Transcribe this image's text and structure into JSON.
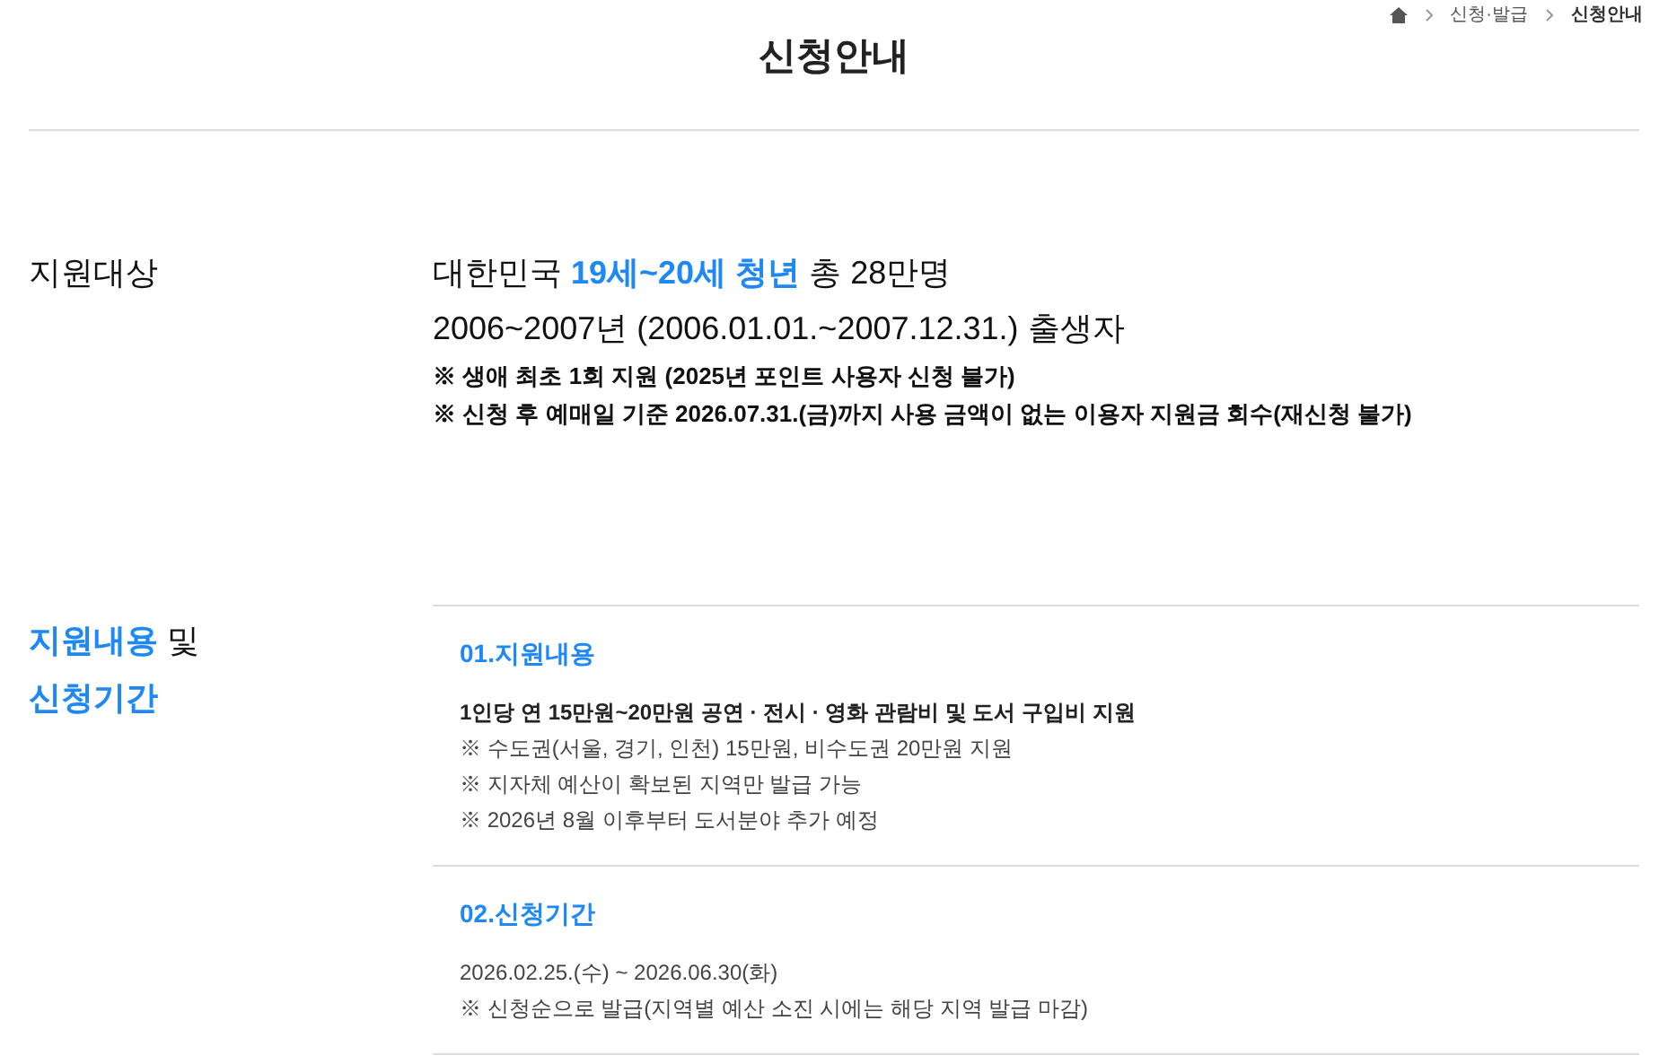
{
  "breadcrumb": [
    {
      "kind": "home"
    },
    {
      "label": "신청·발급",
      "selected": false
    },
    {
      "label": "신청안내",
      "selected": true
    }
  ],
  "title": "신청안내",
  "target": {
    "label": [
      {
        "text": "지원대상",
        "highlight": false
      }
    ],
    "lines": [
      {
        "kind": "lead",
        "parts": [
          {
            "text": "대한민국 ",
            "highlight": false
          },
          {
            "text": "19세~20세 청년",
            "highlight": true
          },
          {
            "text": " 총 28만명",
            "highlight": false
          }
        ]
      },
      {
        "kind": "lead",
        "parts": [
          {
            "text": "2006~2007년 (2006.01.01.~2007.12.31.) 출생자",
            "highlight": false
          }
        ]
      },
      {
        "kind": "note",
        "parts": [
          {
            "text": "※ 생애 최초 1회 지원 (2025년 포인트 사용자 신청 불가)",
            "highlight": false
          }
        ]
      },
      {
        "kind": "note",
        "parts": [
          {
            "text": "※ 신청 후 예매일 기준 2026.07.31.(금)까지 사용 금액이 없는 이용자 지원금 회수(재신청 불가)",
            "highlight": false
          }
        ]
      }
    ]
  },
  "content": {
    "label_lines": [
      [
        {
          "text": "지원내용",
          "highlight": true
        },
        {
          "text": " 및",
          "highlight": false
        }
      ],
      [
        {
          "text": "신청기간",
          "highlight": true
        }
      ]
    ],
    "sections": [
      {
        "heading": "01.지원내용",
        "lines": [
          {
            "text": "1인당 연 15만원~20만원 공연 · 전시 · 영화 관람비 및 도서 구입비 지원",
            "bold": true
          },
          {
            "text": "※ 수도권(서울, 경기, 인천) 15만원, 비수도권 20만원 지원",
            "bold": false
          },
          {
            "text": "※ 지자체 예산이 확보된 지역만 발급 가능",
            "bold": false
          },
          {
            "text": "※ 2026년 8월 이후부터 도서분야 추가 예정",
            "bold": false
          }
        ]
      },
      {
        "heading": "02.신청기간",
        "lines": [
          {
            "text": "2026.02.25.(수) ~ 2026.06.30(화)",
            "bold": false
          },
          {
            "text": "※ 신청순으로 발급(지역별 예산 소진 시에는 해당 지역 발급 마감)",
            "bold": false
          }
        ]
      }
    ]
  }
}
